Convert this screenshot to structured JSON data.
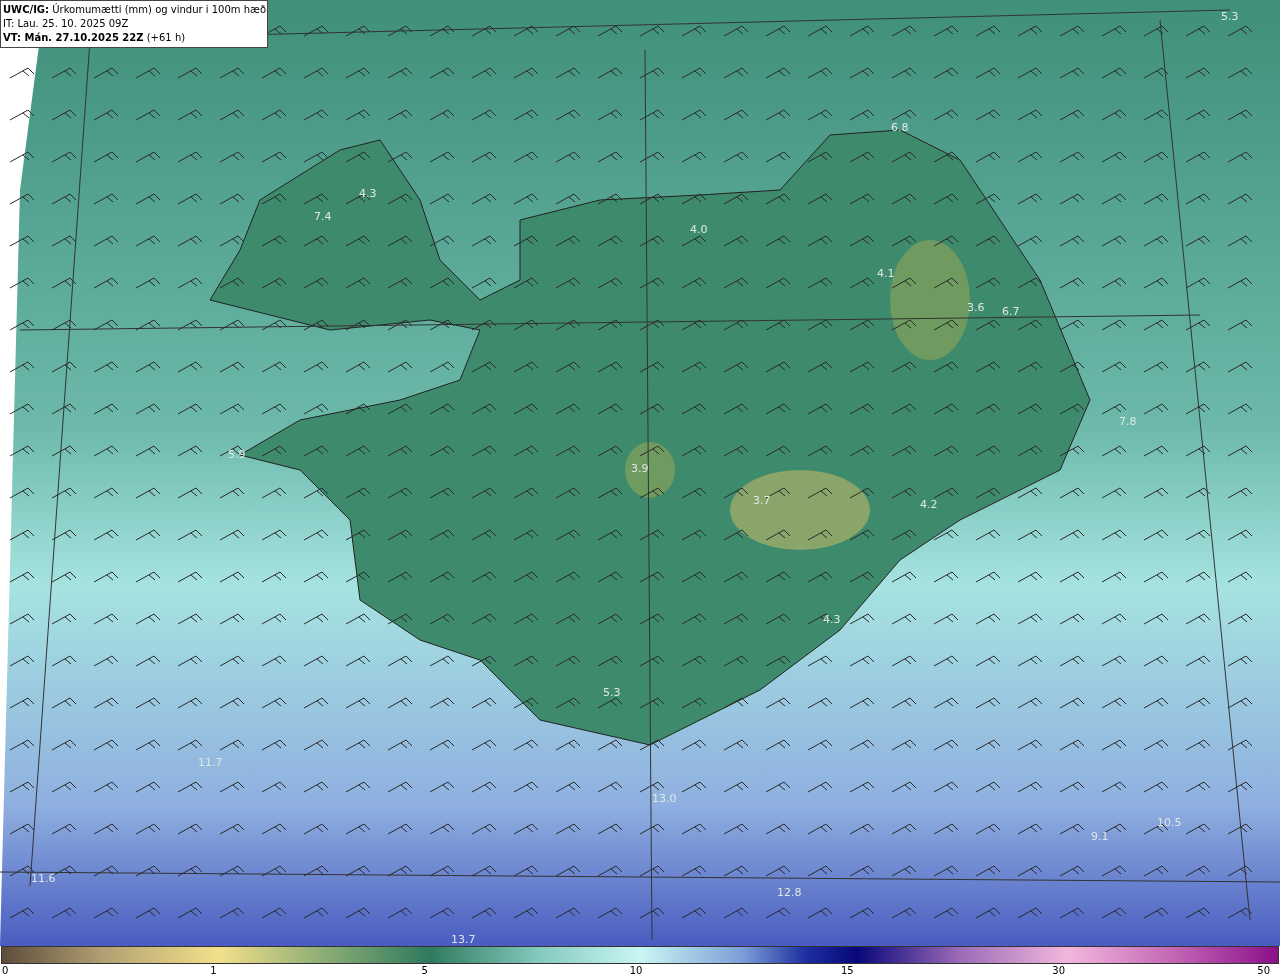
{
  "header": {
    "lines": [
      "**UWC/IG:** Úrkomumætti (mm) og vindur i 100m hæð",
      "IT: Lau. 25. 10. 2025 09Z",
      "**VT: Mán. 27.10.2025 22Z** (+61 h)"
    ]
  },
  "map": {
    "labels": [
      "5.3",
      "6.8",
      "4.3",
      "7.4",
      "4.0",
      "4.1",
      "3.6",
      "6.7",
      "7.8",
      "5.9",
      "3.9",
      "3.7",
      "4.2",
      "4.3",
      "5.3",
      "11.7",
      "13.0",
      "10.5",
      "9.1",
      "11.6",
      "12.8",
      "13.7"
    ]
  },
  "colorbar": {
    "ticks": [
      "0",
      "1",
      "5",
      "10",
      "15",
      "30",
      "50"
    ]
  }
}
